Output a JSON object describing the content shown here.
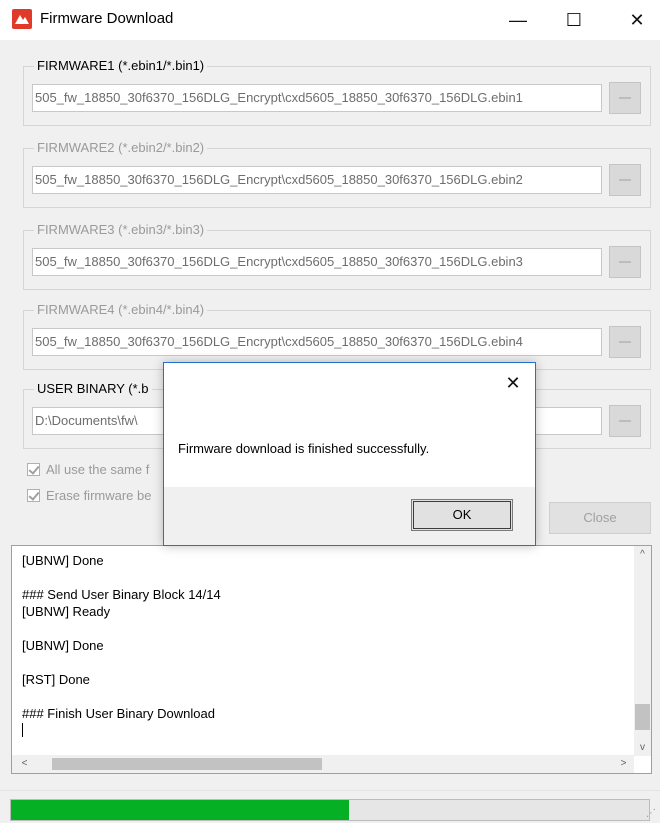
{
  "window": {
    "title": "Firmware Download",
    "minimize_glyph": "—",
    "maximize_glyph": "☐",
    "close_glyph": "✕"
  },
  "groups": [
    {
      "label": "FIRMWARE1 (*.ebin1/*.bin1)",
      "path": "505_fw_18850_30f6370_156DLG_Encrypt\\cxd5605_18850_30f6370_156DLG.ebin1",
      "enabled": true
    },
    {
      "label": "FIRMWARE2 (*.ebin2/*.bin2)",
      "path": "505_fw_18850_30f6370_156DLG_Encrypt\\cxd5605_18850_30f6370_156DLG.ebin2",
      "enabled": false
    },
    {
      "label": "FIRMWARE3 (*.ebin3/*.bin3)",
      "path": "505_fw_18850_30f6370_156DLG_Encrypt\\cxd5605_18850_30f6370_156DLG.ebin3",
      "enabled": false
    },
    {
      "label": "FIRMWARE4 (*.ebin4/*.bin4)",
      "path": "505_fw_18850_30f6370_156DLG_Encrypt\\cxd5605_18850_30f6370_156DLG.ebin4",
      "enabled": false
    },
    {
      "label": "USER BINARY (*.b",
      "path": "D:\\Documents\\fw\\",
      "enabled": true
    }
  ],
  "options": {
    "all_use_same": "All use the same f",
    "erase_firmware": "Erase firmware be"
  },
  "close_button": "Close",
  "log": {
    "lines": [
      "[UBNW] Done",
      "### Send User Binary Block 14/14",
      "[UBNW] Ready",
      "[UBNW] Done",
      "[RST] Done",
      "### Finish User Binary Download"
    ],
    "up_arrow": "^",
    "down_arrow": "v",
    "left_arrow": "<",
    "right_arrow": ">"
  },
  "progress": {
    "fraction": 0.53,
    "fill_color": "#06b025"
  },
  "dialog": {
    "close_glyph": "✕",
    "message": "Firmware download is finished successfully.",
    "ok_label": "OK"
  },
  "colors": {
    "accent_border": "#1e73cf",
    "app_icon_red": "#e03a2a"
  }
}
